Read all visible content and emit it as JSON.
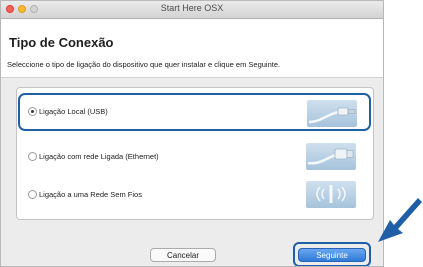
{
  "window": {
    "title": "Start Here OSX"
  },
  "header": {
    "title": "Tipo de Conexão",
    "description": "Seleccione o tipo de ligação do dispositivo que quer instalar e clique em Seguinte."
  },
  "options": [
    {
      "label": "Ligação Local (USB)",
      "selected": true,
      "icon": "usb-cable-icon"
    },
    {
      "label": "Ligação com rede Ligada (Ethernet)",
      "selected": false,
      "icon": "ethernet-cable-icon"
    },
    {
      "label": "Ligação a uma Rede Sem Fios",
      "selected": false,
      "icon": "wireless-icon"
    }
  ],
  "buttons": {
    "cancel": "Cancelar",
    "next": "Seguinte"
  },
  "colors": {
    "highlight": "#1f5fa6",
    "primary_button": "#2f7bd8"
  }
}
